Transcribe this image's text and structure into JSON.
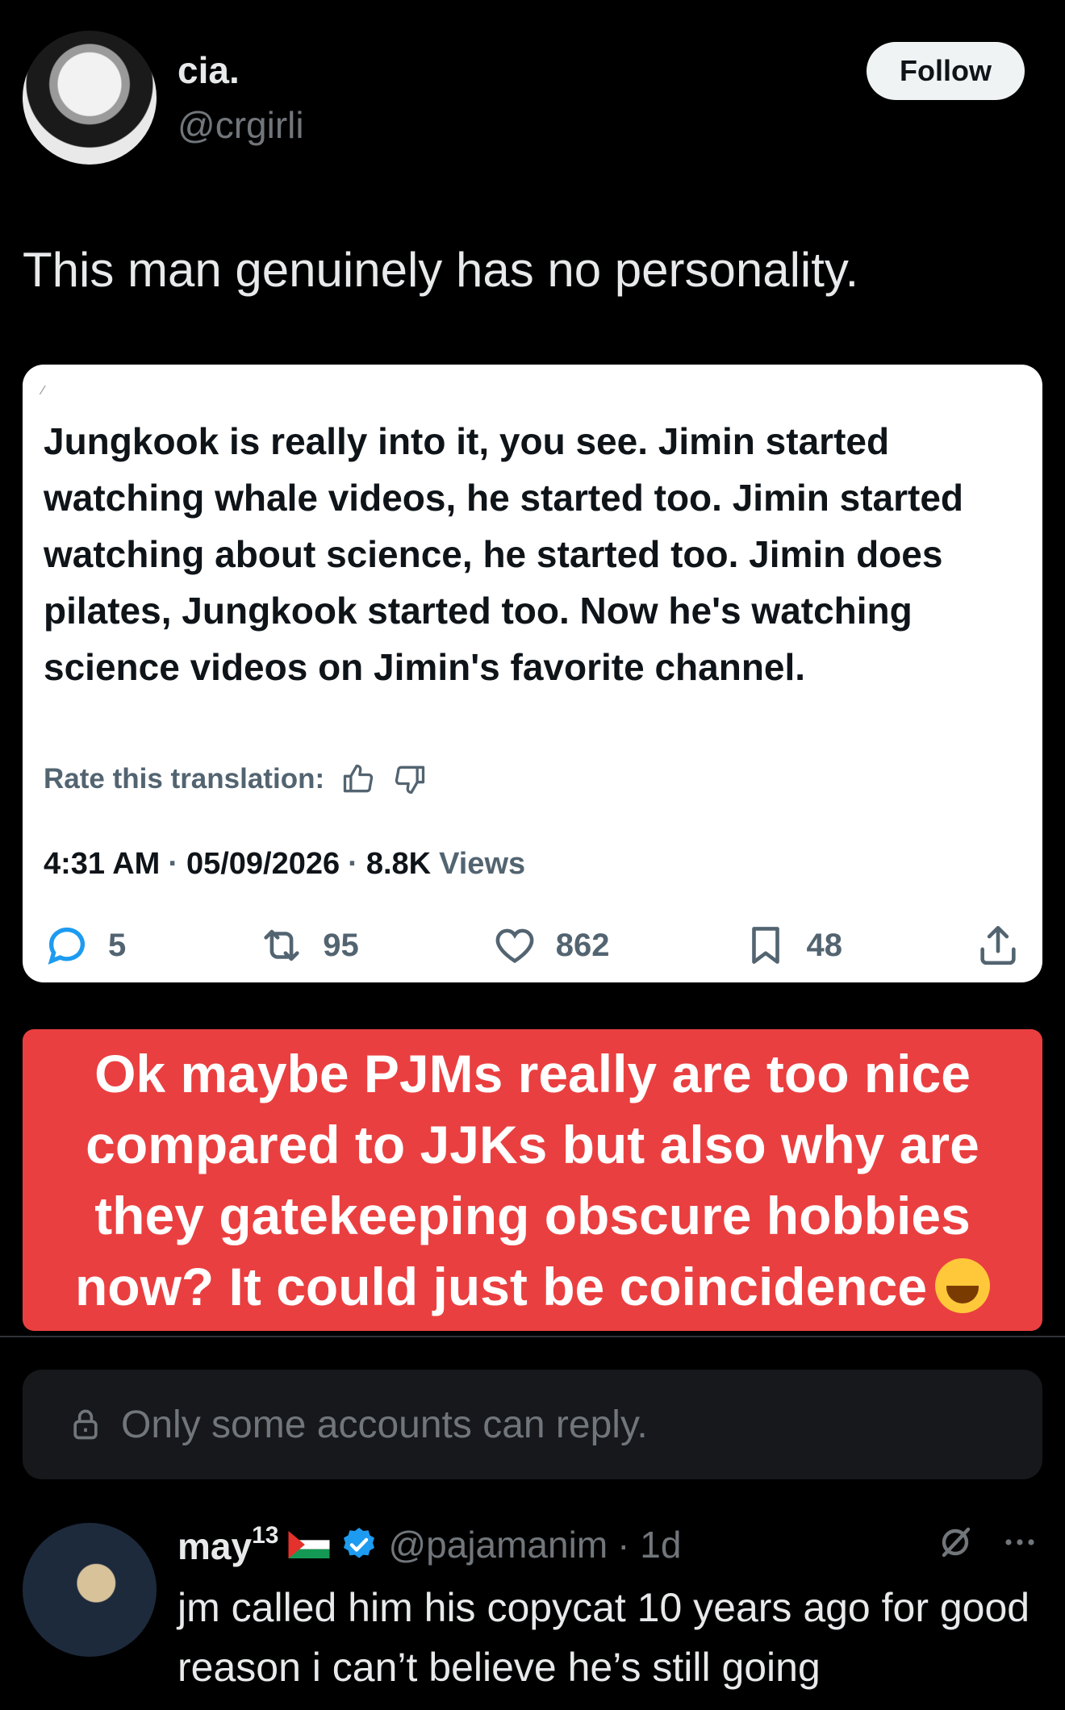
{
  "post": {
    "author_name": "cia.",
    "author_handle": "@crgirli",
    "follow_label": "Follow",
    "text": "This man genuinely has no personality."
  },
  "embedded": {
    "body": "Jungkook is really into it, you see. Jimin started watching whale videos, he started too. Jimin started watching about science, he started too. Jimin does pilates, Jungkook started too. Now he's watching science videos on Jimin's favorite channel.",
    "rate_label": "Rate this translation:",
    "time": "4:31 AM",
    "date": "05/09/2026",
    "views_count": "8.8K",
    "views_label": "Views",
    "sep": "·",
    "replies": "5",
    "reposts": "95",
    "likes": "862",
    "bookmarks": "48"
  },
  "caption": {
    "text": "Ok maybe PJMs really are too nice compared to JJKs but also why are they gatekeeping obscure hobbies now? It could just be coincidence"
  },
  "reply_restriction": {
    "text": "Only some accounts can reply."
  },
  "reply": {
    "name": "may",
    "name_sup": "13",
    "handle": "@pajamanim",
    "time": "· 1d",
    "text": "jm called him his copycat 10 years ago for good reason i can’t believe he’s still going"
  },
  "colors": {
    "background": "#000000",
    "card": "#ffffff",
    "caption_red": "#ea3f40",
    "muted": "#71767b",
    "verified_blue": "#1d9bf0"
  }
}
